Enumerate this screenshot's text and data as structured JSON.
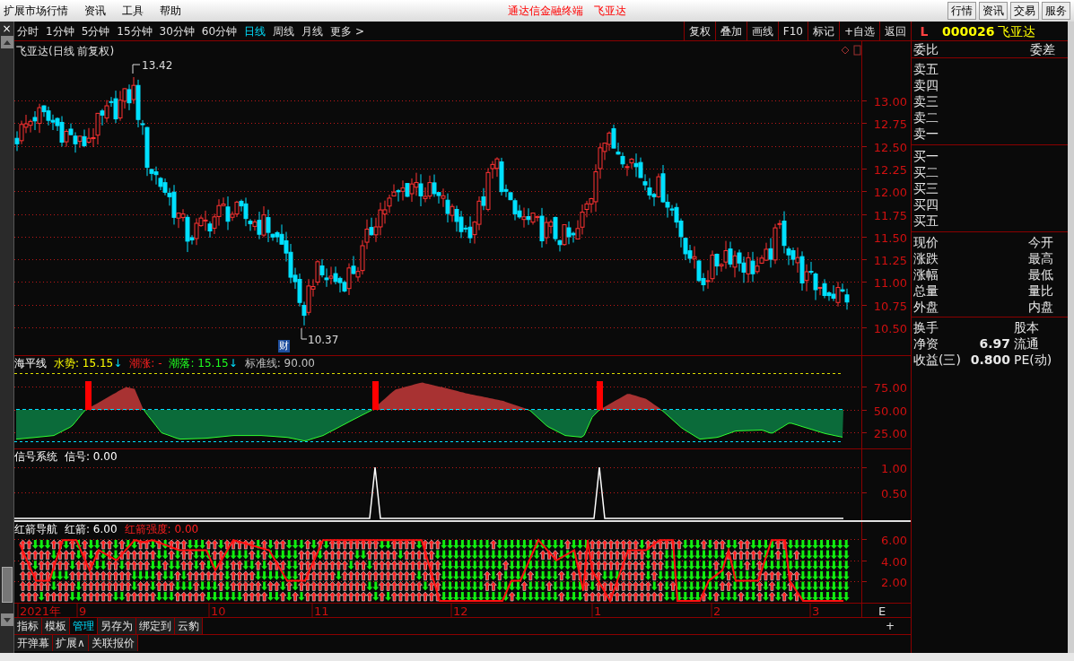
{
  "menu_bar": {
    "items": [
      "扩展市场行情",
      "资讯",
      "工具",
      "帮助"
    ],
    "title": "通达信金融终端",
    "stock": "飞亚达",
    "buttons": [
      "行情",
      "资讯",
      "交易",
      "服务"
    ]
  },
  "period_tabs": [
    {
      "label": "分时",
      "selected": false
    },
    {
      "label": "1分钟",
      "selected": false
    },
    {
      "label": "5分钟",
      "selected": false
    },
    {
      "label": "15分钟",
      "selected": false
    },
    {
      "label": "30分钟",
      "selected": false
    },
    {
      "label": "60分钟",
      "selected": false
    },
    {
      "label": "日线",
      "selected": true
    },
    {
      "label": "周线",
      "selected": false
    },
    {
      "label": "月线",
      "selected": false
    },
    {
      "label": "更多 >",
      "selected": false
    }
  ],
  "tools": [
    "复权",
    "叠加",
    "画线",
    "F10",
    "标记",
    "+自选",
    "返回"
  ],
  "close_glyph": "×",
  "main_chart": {
    "title": "飞亚达(日线 前复权)",
    "high_label": "13.42",
    "low_label": "10.37",
    "marker": "财",
    "yticks": [
      "13.00",
      "12.75",
      "12.50",
      "12.25",
      "12.00",
      "11.75",
      "11.50",
      "11.25",
      "11.00",
      "10.75",
      "10.50"
    ]
  },
  "indicators": [
    {
      "kind": "sea_level",
      "legend": [
        {
          "text": "海平线"
        },
        {
          "text": "水势: 15.15",
          "color": "#ffff00",
          "arrow": "↓"
        },
        {
          "text": "潮涨: -",
          "color": "#ff2020"
        },
        {
          "text": "潮落: 15.15",
          "color": "#20ff20",
          "arrow": "↓"
        },
        {
          "text": "标准线: 90.00",
          "color": "#c0c0c0"
        }
      ],
      "yticks": [
        "75.00",
        "50.00",
        "25.00"
      ]
    },
    {
      "kind": "signal",
      "legend": [
        {
          "text": "信号系统"
        },
        {
          "text": "信号: 0.00"
        }
      ],
      "yticks": [
        "1.00",
        "0.50"
      ]
    },
    {
      "kind": "arrows",
      "legend": [
        {
          "text": "红箭导航"
        },
        {
          "text": "红箭: 6.00"
        },
        {
          "text": "红箭强度: 0.00",
          "color": "#ff2020"
        }
      ],
      "yticks": [
        "6.00",
        "4.00",
        "2.00"
      ]
    }
  ],
  "time_axis": {
    "labels": [
      "2021年",
      "9",
      "10",
      "11",
      "12",
      "1",
      "2",
      "3"
    ],
    "end_label": "E",
    "plus": "+"
  },
  "bottom_tabs": [
    [
      {
        "label": "指标",
        "selected": false
      },
      {
        "label": "模板",
        "selected": false
      },
      {
        "label": "管理",
        "selected": true
      },
      {
        "label": "另存为",
        "selected": false
      },
      {
        "label": "绑定到",
        "selected": false
      },
      {
        "label": "云豹",
        "selected": false
      }
    ],
    [
      {
        "label": "开弹幕",
        "selected": false
      },
      {
        "label": "扩展∧",
        "selected": false
      },
      {
        "label": "关联报价",
        "selected": false
      }
    ]
  ],
  "quote_panel": {
    "flag": "L",
    "code": "000026",
    "name": "飞亚达",
    "ratio": [
      "委比",
      "委差"
    ],
    "sell": [
      "卖五",
      "卖四",
      "卖三",
      "卖二",
      "卖一"
    ],
    "buy": [
      "买一",
      "买二",
      "买三",
      "买四",
      "买五"
    ],
    "stats": [
      {
        "left": "现价",
        "right": "今开"
      },
      {
        "left": "涨跌",
        "right": "最高"
      },
      {
        "left": "涨幅",
        "right": "最低"
      },
      {
        "left": "总量",
        "right": "量比"
      },
      {
        "left": "外盘",
        "right": "内盘"
      }
    ],
    "stats2": [
      {
        "left": "换手",
        "right": "股本"
      },
      {
        "left": "净资",
        "value": "6.97",
        "right": "流通"
      },
      {
        "left": "收益(三)",
        "value": "0.800",
        "right": "PE(动)"
      }
    ]
  }
}
